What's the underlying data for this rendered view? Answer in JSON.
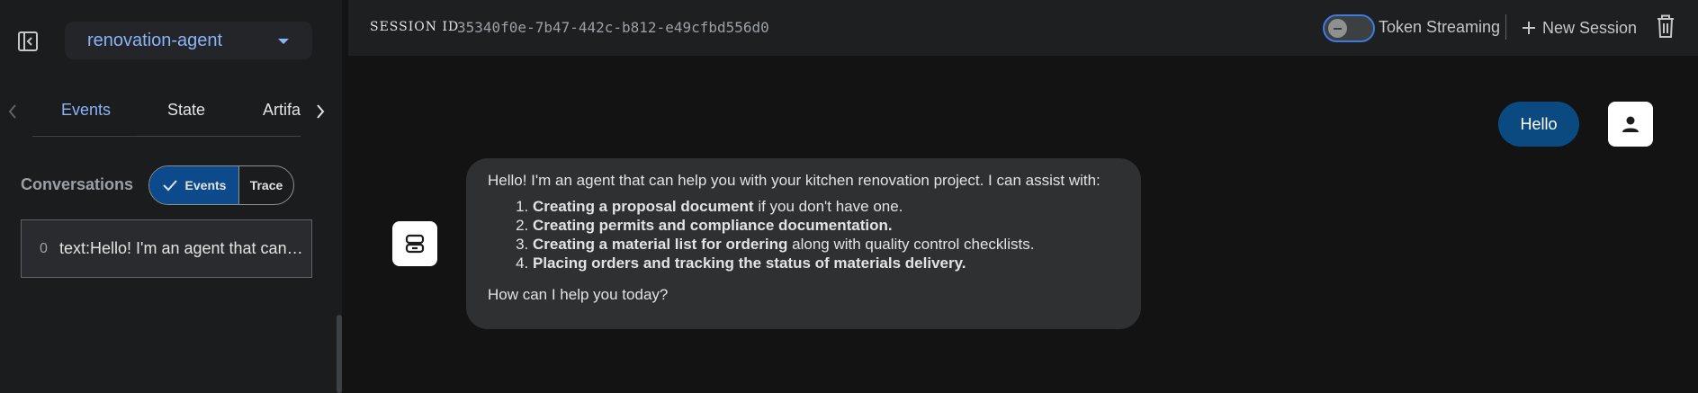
{
  "sidebar": {
    "agent_name": "renovation-agent",
    "tabs": [
      {
        "label": "Events"
      },
      {
        "label": "State"
      },
      {
        "label": "Artifacts"
      }
    ],
    "conversations_label": "Conversations",
    "toggle": {
      "events_label": "Events",
      "trace_label": "Trace"
    },
    "events": [
      {
        "index": "0",
        "text": "text:Hello! I'm an agent that can help you with your kitchen renovation project."
      }
    ]
  },
  "header": {
    "session_label": "SESSION ID",
    "session_id": "35340f0e-7b47-442c-b812-e49cfbd556d0",
    "token_streaming_label": "Token Streaming",
    "new_session_label": "New Session"
  },
  "chat": {
    "user_message": "Hello",
    "bot_intro": "Hello! I'm an agent that can help you with your kitchen renovation project. I can assist with:",
    "bot_list": [
      {
        "bold": "Creating a proposal document",
        "rest": " if you don't have one."
      },
      {
        "bold": "Creating permits and compliance documentation.",
        "rest": ""
      },
      {
        "bold": "Creating a material list for ordering",
        "rest": " along with quality control checklists."
      },
      {
        "bold": "Placing orders and tracking the status of materials delivery.",
        "rest": ""
      }
    ],
    "bot_outro": "How can I help you today?"
  },
  "colors": {
    "accent": "#8ab4f8",
    "user_bubble": "#0b4a80",
    "segment_active": "#0d4a8c",
    "bot_bubble": "#2f3032"
  }
}
